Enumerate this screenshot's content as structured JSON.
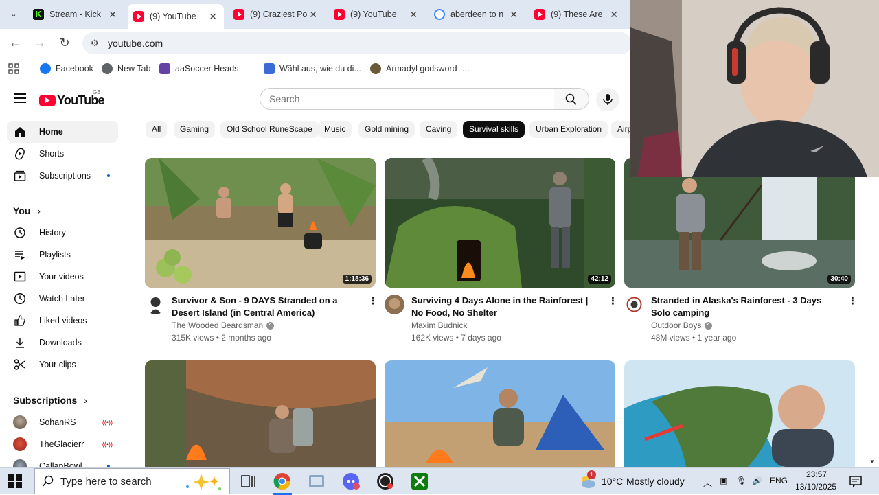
{
  "browser": {
    "tabs": [
      {
        "title": "Stream - Kick",
        "icon": "kick-icon",
        "active": false
      },
      {
        "title": "(9) YouTube",
        "icon": "youtube-icon",
        "active": true
      },
      {
        "title": "(9) Craziest Po",
        "icon": "youtube-icon",
        "active": false
      },
      {
        "title": "(9) YouTube",
        "icon": "youtube-icon",
        "active": false
      },
      {
        "title": "aberdeen to n",
        "icon": "google-icon",
        "active": false
      },
      {
        "title": "(9) These Are",
        "icon": "youtube-icon",
        "active": false
      }
    ],
    "url": "youtube.com",
    "bookmarks": [
      {
        "label": "Facebook",
        "color": "#1877f2"
      },
      {
        "label": "New Tab",
        "color": "#5f6368"
      },
      {
        "label": "aaSoccer Heads",
        "color": "#6441a5"
      },
      {
        "label": "Wähl aus, wie du di...",
        "color": "#3b6bd6"
      },
      {
        "label": "Armadyl godsword -...",
        "color": "#6b5a3a"
      }
    ]
  },
  "youtube": {
    "country_code": "GB",
    "search_placeholder": "Search",
    "sidebar": {
      "main": [
        {
          "label": "Home",
          "icon": "home-icon",
          "active": true
        },
        {
          "label": "Shorts",
          "icon": "shorts-icon"
        },
        {
          "label": "Subscriptions",
          "icon": "subscriptions-icon",
          "dot": true
        }
      ],
      "you_heading": "You",
      "you": [
        {
          "label": "History",
          "icon": "history-icon"
        },
        {
          "label": "Playlists",
          "icon": "playlists-icon"
        },
        {
          "label": "Your videos",
          "icon": "your-videos-icon"
        },
        {
          "label": "Watch Later",
          "icon": "watch-later-icon"
        },
        {
          "label": "Liked videos",
          "icon": "liked-videos-icon"
        },
        {
          "label": "Downloads",
          "icon": "downloads-icon"
        },
        {
          "label": "Your clips",
          "icon": "clips-icon"
        }
      ],
      "subs_heading": "Subscriptions",
      "subscriptions": [
        {
          "label": "SohanRS",
          "live": true
        },
        {
          "label": "TheGlacierr",
          "live": true
        },
        {
          "label": "CallanBowl",
          "dot": true
        }
      ]
    },
    "chips": [
      "All",
      "Gaming",
      "Old School RuneScape",
      "Music",
      "Gold mining",
      "Caving",
      "Survival skills",
      "Urban Exploration",
      "Airp"
    ],
    "selected_chip": "Survival skills",
    "videos": [
      {
        "title": "Survivor & Son - 9 DAYS Stranded on a Desert Island (in Central America)",
        "channel": "The Wooded Beardsman",
        "verified": true,
        "meta": "315K views • 2 months ago",
        "duration": "1:18:36"
      },
      {
        "title": "Surviving 4 Days Alone in the Rainforest | No Food, No Shelter",
        "channel": "Maxim Budnick",
        "verified": false,
        "meta": "162K views • 7 days ago",
        "duration": "42:12"
      },
      {
        "title": "Stranded in Alaska's Rainforest - 3 Days Solo camping",
        "channel": "Outdoor Boys",
        "verified": true,
        "meta": "48M views • 1 year ago",
        "duration": "30:40"
      }
    ]
  },
  "taskbar": {
    "search_placeholder": "Type here to search",
    "weather_badge": "1",
    "temperature": "10°C",
    "weather": "Mostly cloudy",
    "language": "ENG",
    "time": "23:57",
    "date": "13/10/2025"
  }
}
